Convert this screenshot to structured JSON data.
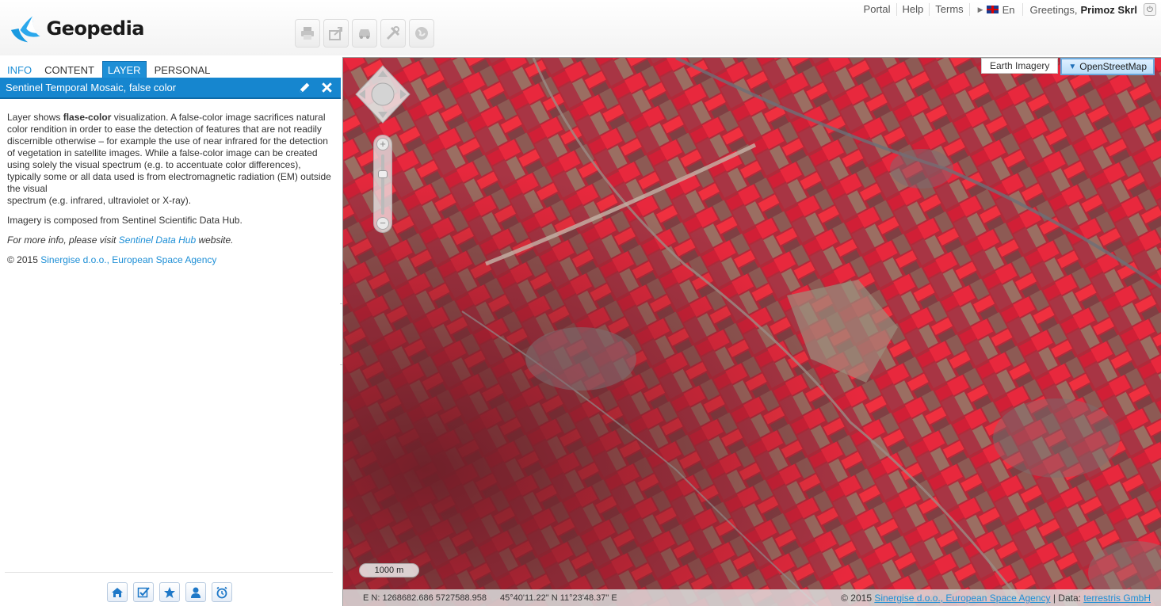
{
  "app": {
    "name": "Geopedia"
  },
  "toolbar": {
    "buttons": [
      {
        "icon": "print-icon"
      },
      {
        "icon": "share-icon"
      },
      {
        "icon": "car-icon"
      },
      {
        "icon": "tools-icon"
      },
      {
        "icon": "globe-icon"
      }
    ]
  },
  "toplinks": {
    "portal": "Portal",
    "help": "Help",
    "terms": "Terms",
    "language": "En",
    "greeting": "Greetings,",
    "user": "Primoz Skrl"
  },
  "tabs": {
    "info": "INFO",
    "content": "CONTENT",
    "layer": "LAYER",
    "personal": "PERSONAL",
    "active": "LAYER"
  },
  "layer": {
    "title": "Sentinel Temporal Mosaic, false color",
    "p1_prefix": "Layer shows ",
    "p1_bold": "flase-color",
    "p1_rest": " visualization.  A false-color image sacrifices natural color rendition in order to ease the detection of features that are not readily discernible otherwise – for example the use of near infrared for the detection of vegetation in satellite images. While a false-color image can be created using solely the visual spectrum (e.g. to accentuate color differences), typically some or all data used is from electromagnetic radiation (EM) outside the visual",
    "p1_tail": "spectrum (e.g. infrared, ultraviolet or X-ray).",
    "p2": "Imagery is composed from Sentinel Scientific Data Hub.",
    "p3_prefix": "For more info, please visit ",
    "p3_link": "Sentinel Data Hub",
    "p3_suffix": " website.",
    "p4_prefix": "© 2015  ",
    "p4_link": "Sinergise d.o.o., European Space Agency"
  },
  "bottom_icons": [
    "home-icon",
    "checklist-icon",
    "star-icon",
    "user-icon",
    "alarm-clock-icon"
  ],
  "map": {
    "basemaps": {
      "earth": "Earth Imagery",
      "osm": "OpenStreetMap",
      "selected": "OpenStreetMap"
    },
    "scale": "1000 m",
    "coords_en": "E N: 1268682.686 5727588.958",
    "coords_ll": "45°40'11.22\" N 11°23'48.37\" E",
    "credit_prefix": "© 2015 ",
    "credit_link1": "Sinergise d.o.o., European Space Agency",
    "credit_mid": " | Data: ",
    "credit_link2": "terrestris GmbH"
  },
  "colors": {
    "accent": "#1686cf",
    "map_red": "#e02a3c",
    "map_dark": "#7a2430"
  }
}
